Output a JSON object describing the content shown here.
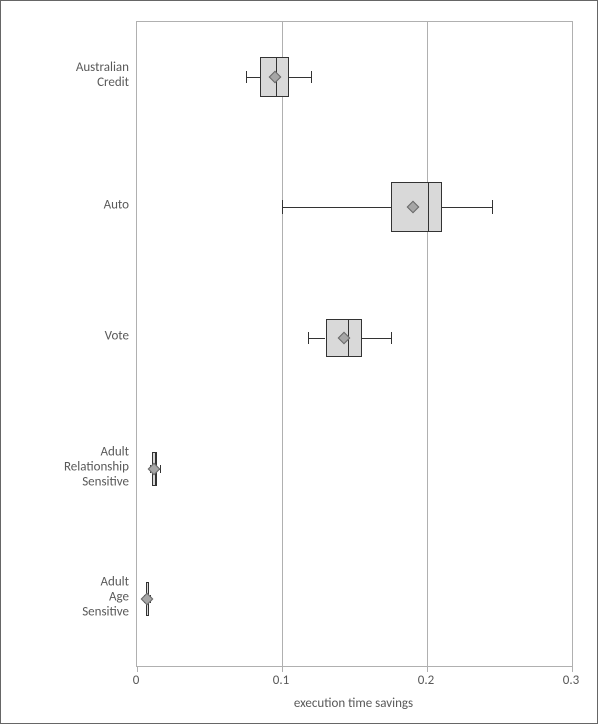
{
  "chart_data": {
    "type": "boxplot",
    "orientation": "horizontal",
    "xlabel": "execution time savings",
    "ylabel": "",
    "xlim": [
      0,
      0.3
    ],
    "xticks": [
      0,
      0.1,
      0.2,
      0.3
    ],
    "gridlines_x": [
      0.1,
      0.2
    ],
    "categories": [
      "Australian\nCredit",
      "Auto",
      "Vote",
      "Adult\nRelationship\nSensitive",
      "Adult\nAge\nSensitive"
    ],
    "series": [
      {
        "name": "Australian Credit",
        "min": 0.075,
        "q1": 0.085,
        "median": 0.095,
        "q3": 0.105,
        "max": 0.12,
        "mean": 0.095
      },
      {
        "name": "Auto",
        "min": 0.1,
        "q1": 0.175,
        "median": 0.2,
        "q3": 0.21,
        "max": 0.245,
        "mean": 0.19
      },
      {
        "name": "Vote",
        "min": 0.118,
        "q1": 0.13,
        "median": 0.145,
        "q3": 0.155,
        "max": 0.175,
        "mean": 0.143
      },
      {
        "name": "Adult Relationship Sensitive",
        "min": 0.009,
        "q1": 0.01,
        "median": 0.012,
        "q3": 0.014,
        "max": 0.016,
        "mean": 0.012
      },
      {
        "name": "Adult Age Sensitive",
        "min": 0.005,
        "q1": 0.006,
        "median": 0.007,
        "q3": 0.008,
        "max": 0.009,
        "mean": 0.007
      }
    ]
  },
  "layout": {
    "box_heights": [
      40,
      50,
      38,
      34,
      34
    ],
    "cap_heights": [
      12,
      14,
      12,
      8,
      8
    ],
    "row_centers_frac": [
      0.085,
      0.288,
      0.49,
      0.694,
      0.896
    ]
  }
}
